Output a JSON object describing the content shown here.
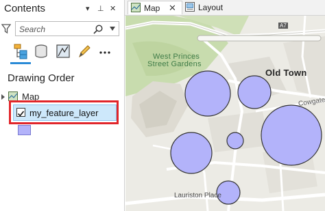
{
  "contents_pane": {
    "title": "Contents",
    "controls": {
      "dropdown": "▾",
      "pin": "⊥",
      "close": "✕"
    },
    "search": {
      "placeholder": "Search",
      "value": ""
    },
    "toolbar": [
      "list-by-drawing-order-icon",
      "list-by-data-source-icon",
      "list-by-selection-icon",
      "list-by-editing-icon",
      "more-options-icon"
    ],
    "section_title": "Drawing Order",
    "map_node": "Map",
    "layer": {
      "name": "my_feature_layer",
      "checked": true,
      "symbol_color": "#b3b3fa"
    }
  },
  "view_tabs": [
    {
      "label": "Map",
      "active": true,
      "icon": "map-tab-icon"
    },
    {
      "label": "Layout",
      "active": false,
      "icon": "layout-tab-icon"
    }
  ],
  "map": {
    "labels": {
      "west_princes_1": "West Princes",
      "west_princes_2": "Street Gardens",
      "old_town": "Old Town",
      "cowgate": "Cowgate",
      "lauriston": "Lauriston Place",
      "road_shield": "A7"
    },
    "point_fill": "#b3b3fa",
    "point_stroke": "#333333"
  },
  "colors": {
    "highlight": "#e1252a",
    "selection": "#cde8fb",
    "accent": "#2a8ad6"
  }
}
